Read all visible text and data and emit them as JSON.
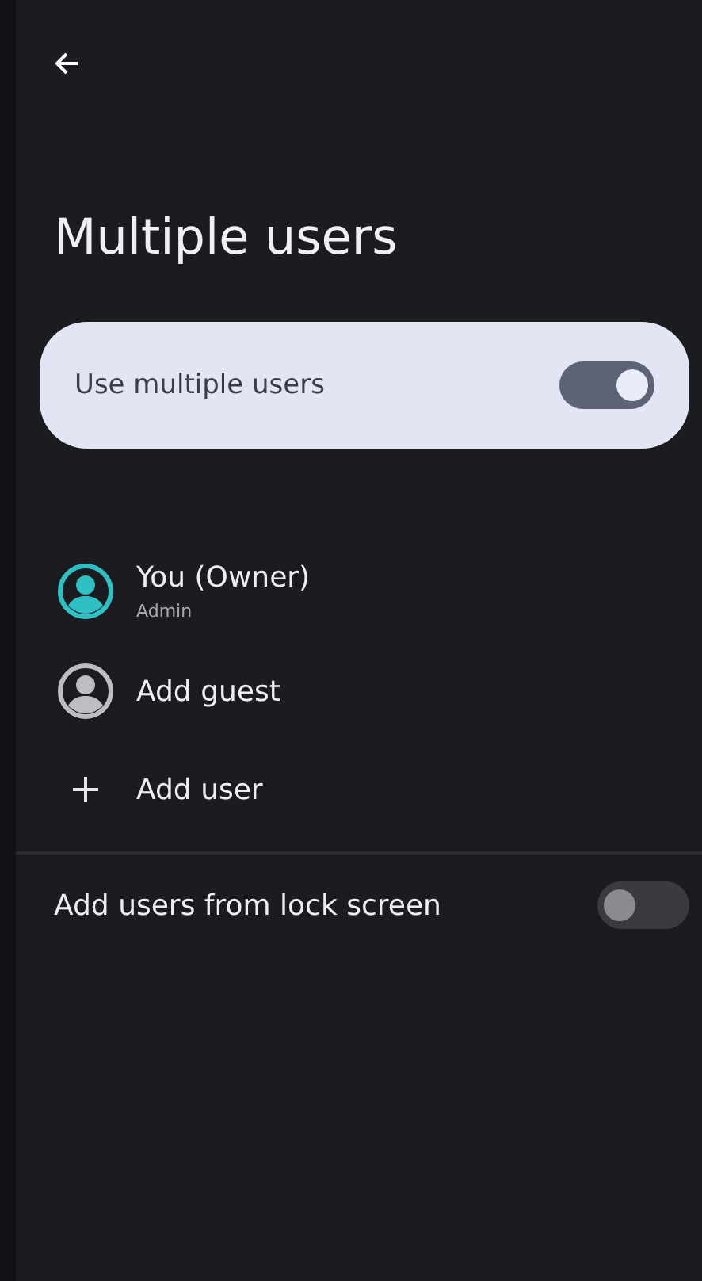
{
  "title": "Multiple users",
  "main_switch": {
    "label": "Use multiple users",
    "on": true
  },
  "users": [
    {
      "kind": "owner",
      "label": "You (Owner)",
      "subtitle": "Admin"
    },
    {
      "kind": "guest",
      "label": "Add guest"
    },
    {
      "kind": "add",
      "label": "Add user"
    }
  ],
  "lock_screen_switch": {
    "label": "Add users from lock screen",
    "on": false
  }
}
